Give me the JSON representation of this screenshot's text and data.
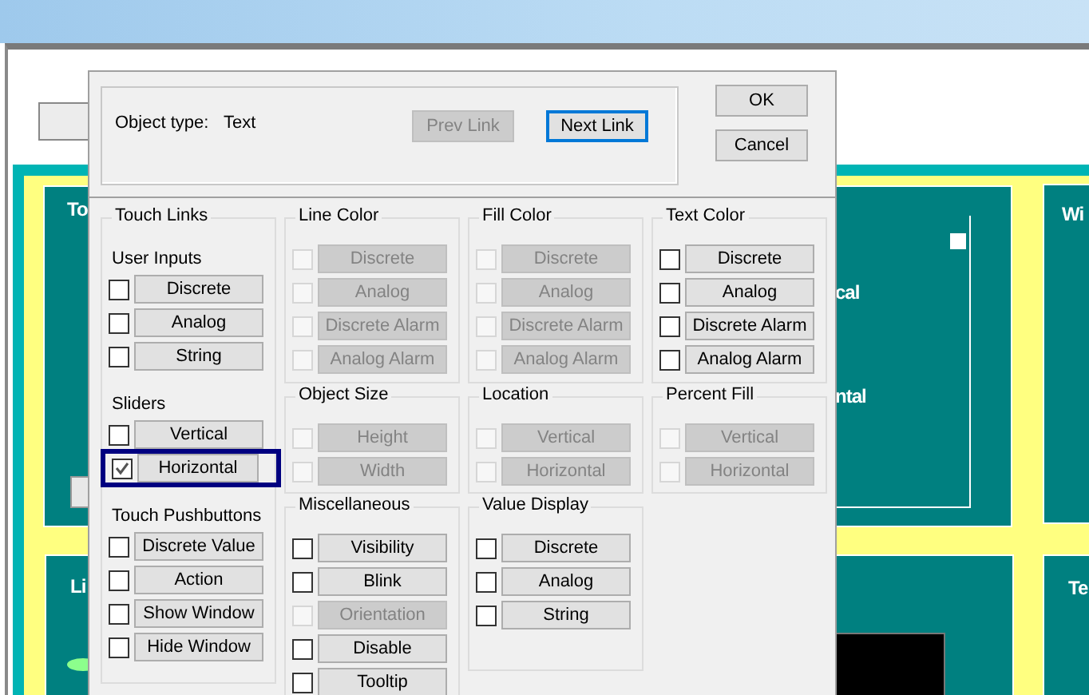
{
  "canvas": {
    "labels": [
      "To",
      "cal",
      "ntal",
      "Wi",
      "Li",
      "Te"
    ]
  },
  "dialog": {
    "object_type_label": "Object type:",
    "object_type": "Text",
    "links": [
      {
        "label": "Prev Link",
        "disabled": true,
        "focused": false
      },
      {
        "label": "Next Link",
        "disabled": false,
        "focused": true
      }
    ],
    "buttons": [
      "OK",
      "Cancel"
    ],
    "columns": [
      [
        {
          "title": "Touch Links",
          "sections": [
            {
              "title": "User Inputs",
              "items": [
                {
                  "label": "Discrete",
                  "checked": false,
                  "disabled": false,
                  "focused": false
                },
                {
                  "label": "Analog",
                  "checked": false,
                  "disabled": false,
                  "focused": false
                },
                {
                  "label": "String",
                  "checked": false,
                  "disabled": false,
                  "focused": false
                }
              ]
            },
            {
              "title": "Sliders",
              "items": [
                {
                  "label": "Vertical",
                  "checked": false,
                  "disabled": false,
                  "focused": false
                },
                {
                  "label": "Horizontal",
                  "checked": true,
                  "disabled": false,
                  "focused": true
                }
              ]
            },
            {
              "title": "Touch Pushbuttons",
              "items": [
                {
                  "label": "Discrete Value",
                  "checked": false,
                  "disabled": false,
                  "focused": false
                },
                {
                  "label": "Action",
                  "checked": false,
                  "disabled": false,
                  "focused": false
                },
                {
                  "label": "Show Window",
                  "checked": false,
                  "disabled": false,
                  "focused": false
                },
                {
                  "label": "Hide Window",
                  "checked": false,
                  "disabled": false,
                  "focused": false
                }
              ]
            }
          ]
        }
      ],
      [
        {
          "title": "Line Color",
          "sections": [
            {
              "items": [
                {
                  "label": "Discrete",
                  "checked": false,
                  "disabled": true,
                  "focused": false
                },
                {
                  "label": "Analog",
                  "checked": false,
                  "disabled": true,
                  "focused": false
                },
                {
                  "label": "Discrete Alarm",
                  "checked": false,
                  "disabled": true,
                  "focused": false
                },
                {
                  "label": "Analog Alarm",
                  "checked": false,
                  "disabled": true,
                  "focused": false
                }
              ]
            }
          ]
        },
        {
          "title": "Object Size",
          "sections": [
            {
              "items": [
                {
                  "label": "Height",
                  "checked": false,
                  "disabled": true,
                  "focused": false
                },
                {
                  "label": "Width",
                  "checked": false,
                  "disabled": true,
                  "focused": false
                }
              ]
            }
          ]
        },
        {
          "title": "Miscellaneous",
          "sections": [
            {
              "items": [
                {
                  "label": "Visibility",
                  "checked": false,
                  "disabled": false,
                  "focused": false
                },
                {
                  "label": "Blink",
                  "checked": false,
                  "disabled": false,
                  "focused": false
                },
                {
                  "label": "Orientation",
                  "checked": false,
                  "disabled": true,
                  "focused": false
                },
                {
                  "label": "Disable",
                  "checked": false,
                  "disabled": false,
                  "focused": false
                },
                {
                  "label": "Tooltip",
                  "checked": false,
                  "disabled": false,
                  "focused": false
                }
              ]
            }
          ]
        }
      ],
      [
        {
          "title": "Fill Color",
          "sections": [
            {
              "items": [
                {
                  "label": "Discrete",
                  "checked": false,
                  "disabled": true,
                  "focused": false
                },
                {
                  "label": "Analog",
                  "checked": false,
                  "disabled": true,
                  "focused": false
                },
                {
                  "label": "Discrete Alarm",
                  "checked": false,
                  "disabled": true,
                  "focused": false
                },
                {
                  "label": "Analog Alarm",
                  "checked": false,
                  "disabled": true,
                  "focused": false
                }
              ]
            }
          ]
        },
        {
          "title": "Location",
          "sections": [
            {
              "items": [
                {
                  "label": "Vertical",
                  "checked": false,
                  "disabled": true,
                  "focused": false
                },
                {
                  "label": "Horizontal",
                  "checked": false,
                  "disabled": true,
                  "focused": false
                }
              ]
            }
          ]
        },
        {
          "title": "Value Display",
          "sections": [
            {
              "items": [
                {
                  "label": "Discrete",
                  "checked": false,
                  "disabled": false,
                  "focused": false
                },
                {
                  "label": "Analog",
                  "checked": false,
                  "disabled": false,
                  "focused": false
                },
                {
                  "label": "String",
                  "checked": false,
                  "disabled": false,
                  "focused": false
                }
              ]
            }
          ]
        }
      ],
      [
        {
          "title": "Text Color",
          "sections": [
            {
              "items": [
                {
                  "label": "Discrete",
                  "checked": false,
                  "disabled": false,
                  "focused": false
                },
                {
                  "label": "Analog",
                  "checked": false,
                  "disabled": false,
                  "focused": false
                },
                {
                  "label": "Discrete Alarm",
                  "checked": false,
                  "disabled": false,
                  "focused": false
                },
                {
                  "label": "Analog Alarm",
                  "checked": false,
                  "disabled": false,
                  "focused": false
                }
              ]
            }
          ]
        },
        {
          "title": "Percent Fill",
          "sections": [
            {
              "items": [
                {
                  "label": "Vertical",
                  "checked": false,
                  "disabled": true,
                  "focused": false
                },
                {
                  "label": "Horizontal",
                  "checked": false,
                  "disabled": true,
                  "focused": false
                }
              ]
            }
          ]
        }
      ]
    ]
  }
}
